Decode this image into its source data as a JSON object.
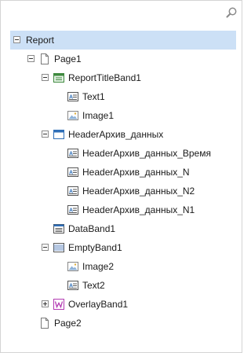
{
  "search": {
    "value": "",
    "placeholder": ""
  },
  "tree": {
    "report": "Report",
    "page1": "Page1",
    "report_title_band": "ReportTitleBand1",
    "text1": "Text1",
    "image1": "Image1",
    "header_band": "HeaderАрхив_данных",
    "header_time": "HeaderАрхив_данных_Время",
    "header_n": "HeaderАрхив_данных_N",
    "header_n2": "HeaderАрхив_данных_N2",
    "header_n1": "HeaderАрхив_данных_N1",
    "data_band": "DataBand1",
    "empty_band": "EmptyBand1",
    "image2": "Image2",
    "text2": "Text2",
    "overlay_band": "OverlayBand1",
    "page2": "Page2"
  },
  "colors": {
    "selection": "#cce0f6",
    "band_green": "#3f8a3f",
    "band_blue": "#2f6fb8",
    "overlay_purple": "#b23ab2"
  }
}
